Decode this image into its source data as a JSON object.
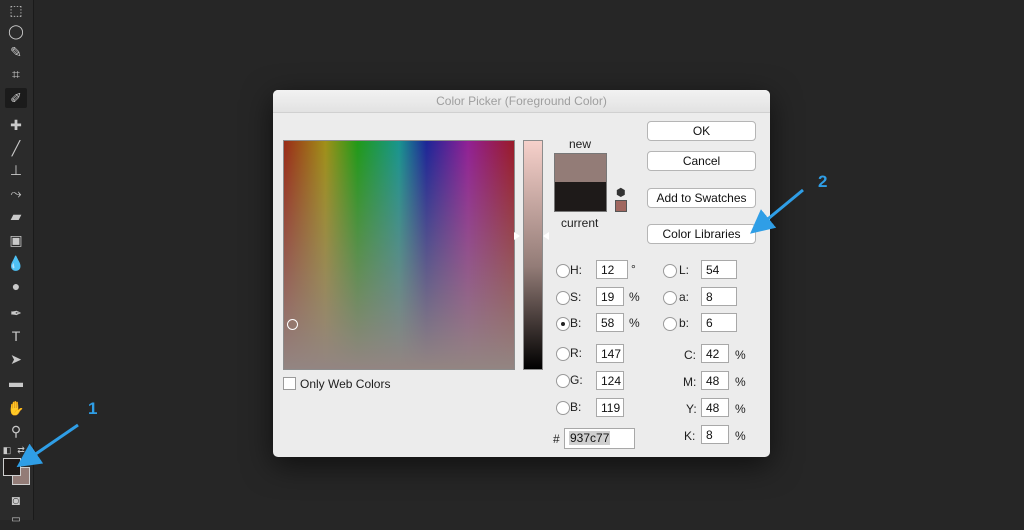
{
  "dialog": {
    "title": "Color Picker (Foreground Color)",
    "new_label": "new",
    "current_label": "current",
    "new_color": "#937c77",
    "current_color": "#1e1a19",
    "buttons": {
      "ok": "OK",
      "cancel": "Cancel",
      "add_to_swatches": "Add to Swatches",
      "color_libraries": "Color Libraries"
    },
    "only_web_colors": "Only Web Colors",
    "hsb": {
      "h_label": "H:",
      "h_value": "12",
      "h_unit": "°",
      "s_label": "S:",
      "s_value": "19",
      "s_unit": "%",
      "b_label": "B:",
      "b_value": "58",
      "b_unit": "%"
    },
    "rgb": {
      "r_label": "R:",
      "r_value": "147",
      "g_label": "G:",
      "g_value": "124",
      "b_label": "B:",
      "b_value": "119"
    },
    "lab": {
      "l_label": "L:",
      "l_value": "54",
      "a_label": "a:",
      "a_value": "8",
      "b_label": "b:",
      "b_value": "6"
    },
    "cmyk": {
      "c_label": "C:",
      "c_value": "42",
      "m_label": "M:",
      "m_value": "48",
      "y_label": "Y:",
      "y_value": "48",
      "k_label": "K:",
      "k_value": "8",
      "unit": "%"
    },
    "hex_label": "#",
    "hex_value": "937c77",
    "selected_mode": "B"
  },
  "annotations": {
    "marker_1": "1",
    "marker_2": "2",
    "color": "#2f9ee6"
  },
  "toolbar": {
    "tools": [
      "marquee-icon",
      "lasso-icon",
      "quick-select-icon",
      "crop-icon",
      "eyedropper-icon",
      "healing-icon",
      "brush-icon",
      "stamp-icon",
      "history-brush-icon",
      "eraser-icon",
      "gradient-icon",
      "blur-icon",
      "dodge-icon",
      "pen-icon",
      "type-icon",
      "path-select-icon",
      "shape-icon",
      "hand-icon",
      "zoom-icon"
    ],
    "active_tool": "eyedropper-icon",
    "type_tool_glyph": "T"
  }
}
